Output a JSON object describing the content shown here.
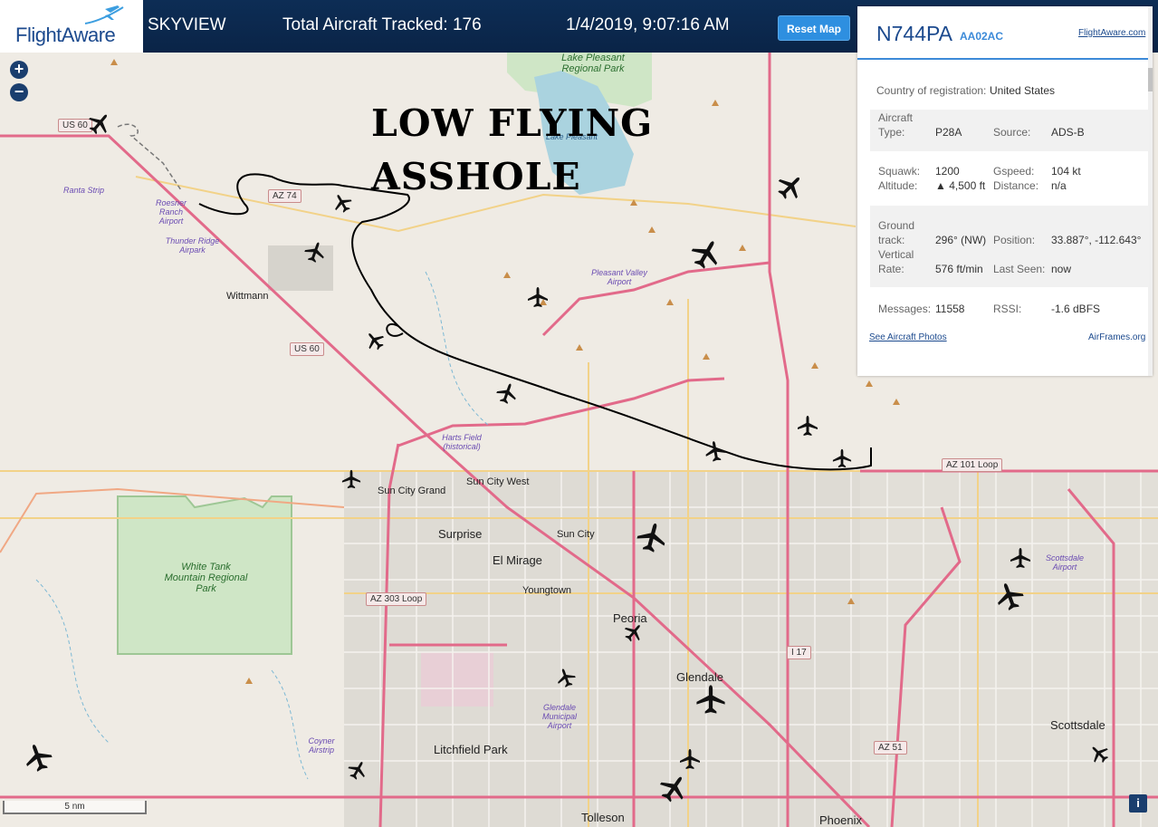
{
  "header": {
    "logo_text": "FlightAware",
    "site_name": "SKYVIEW",
    "tracked": "Total Aircraft Tracked: 176",
    "datetime": "1/4/2019, 9:07:16 AM",
    "reset_label": "Reset Map"
  },
  "overlay": {
    "line1": "LOW FLYING",
    "line2": "ASSHOLE"
  },
  "map_controls": {
    "zoom_in": "+",
    "zoom_out": "−",
    "scale": "5 nm",
    "info": "i"
  },
  "panel": {
    "ident": "N744PA",
    "hex": "AA02AC",
    "fa_link": "FlightAware.com",
    "country_label": "Country of registration:",
    "country_value": "United States",
    "type_label": "Aircraft Type:",
    "type_label_a": "Aircraft",
    "type_label_b": "Type:",
    "type_value": "P28A",
    "source_label": "Source:",
    "source_value": "ADS-B",
    "squawk_label": "Squawk:",
    "squawk_value": "1200",
    "gspeed_label": "Gspeed:",
    "gspeed_value": "104 kt",
    "altitude_label": "Altitude:",
    "altitude_value": "▲ 4,500 ft",
    "distance_label": "Distance:",
    "distance_value": "n/a",
    "track_label_a": "Ground",
    "track_label_b": "track:",
    "track_value": "296° (NW)",
    "position_label": "Position:",
    "position_value": "33.887°, -112.643°",
    "vrate_label_a": "Vertical",
    "vrate_label_b": "Rate:",
    "vrate_value": "576 ft/min",
    "lastseen_label": "Last Seen:",
    "lastseen_value": "now",
    "messages_label": "Messages:",
    "messages_value": "11558",
    "rssi_label": "RSSI:",
    "rssi_value": "-1.6 dBFS",
    "photos_link": "See Aircraft Photos",
    "airframes_link": "AirFrames.org"
  },
  "map_labels": {
    "cities_large": [
      "Surprise",
      "El Mirage",
      "Peoria",
      "Glendale",
      "Litchfield Park",
      "Scottsdale",
      "Tolleson",
      "Phoenix"
    ],
    "cities_small": [
      "Wittmann",
      "Sun City Grand",
      "Sun City West",
      "Sun City",
      "Youngtown"
    ],
    "parks": [
      "Lake Pleasant Regional Park",
      "Lake Pleasant",
      "White Tank Mountain Regional Park"
    ],
    "airports": [
      "Ranta Strip",
      "Roesner Ranch Airport",
      "Thunder Ridge Airpark",
      "Pleasant Valley Airport",
      "Harts Field (historical)",
      "Glendale Municipal Airport",
      "Coyner Airstrip",
      "Scottsdale Airport"
    ],
    "shields": [
      "US 60",
      "AZ 74",
      "US 60",
      "AZ 303 Loop",
      "AZ 101 Loop",
      "I 17",
      "AZ 51"
    ]
  },
  "colors": {
    "header_bg": "#0a2447",
    "accent": "#2e8fe0",
    "link": "#1c4a8e",
    "map_bg": "#efebe4",
    "road_major": "#e26a8a"
  }
}
